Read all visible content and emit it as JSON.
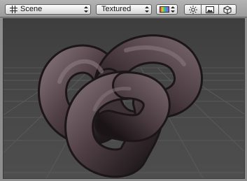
{
  "toolbar": {
    "scene_label": "Scene",
    "shading_label": "Textured",
    "buttons": [
      "grid-icon",
      "color-swatch-icon",
      "sun-icon",
      "image-icon",
      "cube-icon"
    ]
  },
  "viewport": {
    "background_color": "#4a4a4a",
    "object": "torus-knot",
    "object_color": "#5d4a50"
  }
}
